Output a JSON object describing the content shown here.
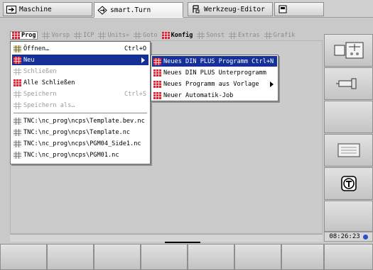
{
  "tabs": [
    {
      "label": "Maschine",
      "icon": "machine-arrow-icon"
    },
    {
      "label": "smart.Turn",
      "icon": "diamond-arrows-icon"
    },
    {
      "label": "Werkzeug-Editor",
      "icon": "tool-editor-icon"
    },
    {
      "label": "",
      "icon": "monitor-icon"
    }
  ],
  "menubar": [
    {
      "label": "Prog",
      "enabled": true,
      "selected": true
    },
    {
      "label": "Vorsp",
      "enabled": false
    },
    {
      "label": "ICP",
      "enabled": false
    },
    {
      "label": "Units»",
      "enabled": false
    },
    {
      "label": "Goto",
      "enabled": false
    },
    {
      "label": "Konfig",
      "enabled": true
    },
    {
      "label": "Sonst",
      "enabled": false
    },
    {
      "label": "Extras",
      "enabled": false
    },
    {
      "label": "Grafik",
      "enabled": false
    }
  ],
  "prog_menu": {
    "items": [
      {
        "label": "Öffnen…",
        "shortcut": "Ctrl+O",
        "state": "normal"
      },
      {
        "label": "Neu",
        "shortcut": "",
        "state": "highlighted",
        "submenu": true
      },
      {
        "label": "Schließen",
        "shortcut": "",
        "state": "disabled"
      },
      {
        "label": "Alle Schließen",
        "shortcut": "",
        "state": "normal"
      },
      {
        "label": "Speichern",
        "shortcut": "Ctrl+S",
        "state": "disabled"
      },
      {
        "label": "Speichern als…",
        "shortcut": "",
        "state": "disabled"
      }
    ],
    "recent_files": [
      "TNC:\\nc_prog\\ncps\\Template.bev.nc",
      "TNC:\\nc_prog\\ncps\\Template.nc",
      "TNC:\\nc_prog\\ncps\\PGM04_Side1.nc",
      "TNC:\\nc_prog\\ncps\\PGM01.nc"
    ]
  },
  "neu_submenu": [
    {
      "label": "Neues DIN PLUS Programm Ctrl+N",
      "state": "highlighted"
    },
    {
      "label": "Neues DIN PLUS Unterprogramm",
      "state": "normal"
    },
    {
      "label": "Neues Programm aus Vorlage",
      "state": "normal",
      "submenu": true
    },
    {
      "label": "Neuer Automatik-Job",
      "state": "normal"
    }
  ],
  "right_softkeys": [
    {
      "icon": "machine-view-icon"
    },
    {
      "icon": "spindle-tool-icon"
    },
    {
      "icon": ""
    },
    {
      "icon": "tool-list-icon"
    },
    {
      "icon": "t-tool-icon"
    },
    {
      "icon": ""
    }
  ],
  "status": {
    "clock": "08:26:23"
  },
  "colors": {
    "highlight": "#16309a",
    "background": "#c9c9c9",
    "menu_bg": "#ffffff"
  }
}
